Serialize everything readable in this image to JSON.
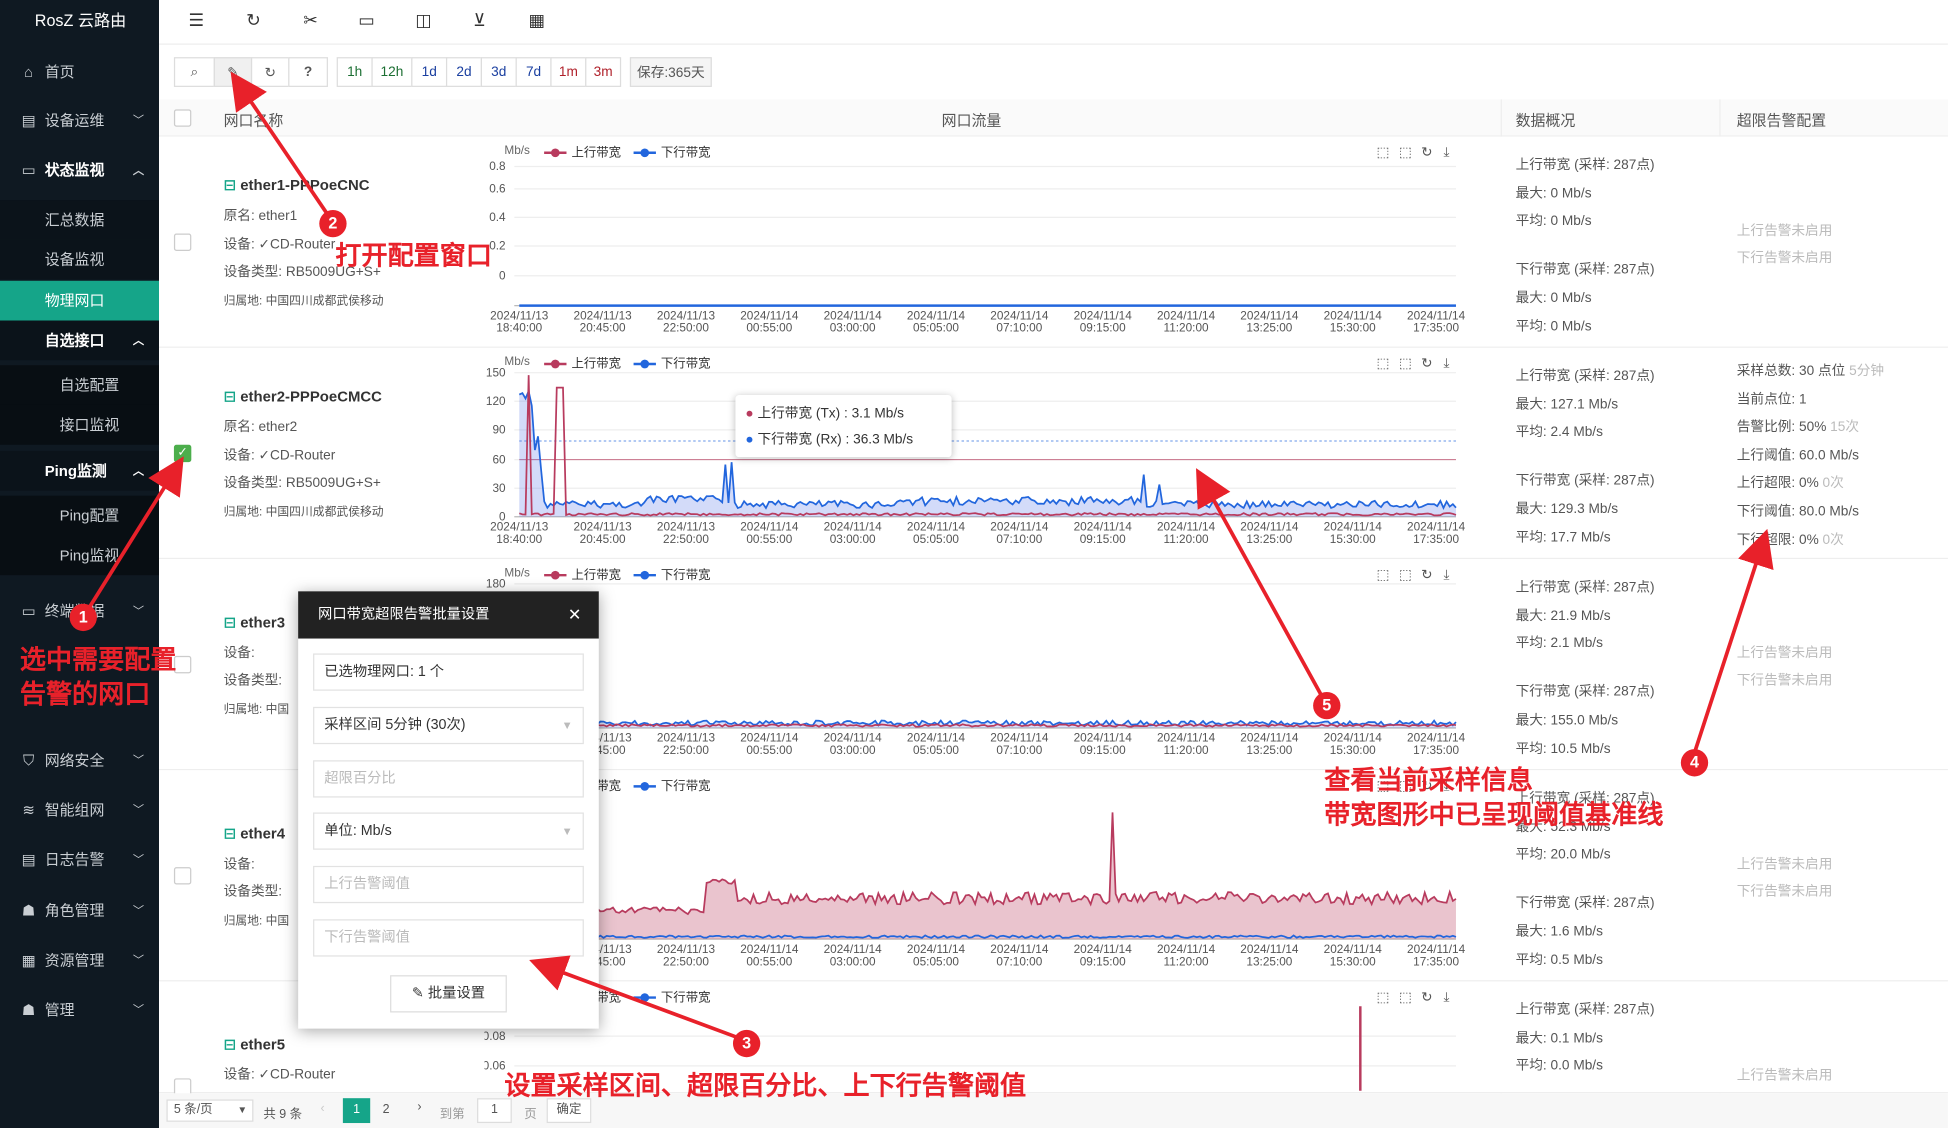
{
  "app": {
    "brand": "RosZ 云路由"
  },
  "sidebar": {
    "items": [
      {
        "label": "首页",
        "icon": "home-icon"
      },
      {
        "label": "设备运维",
        "icon": "toolbox-icon"
      },
      {
        "label": "状态监视",
        "icon": "monitor-icon"
      },
      {
        "label": "汇总数据"
      },
      {
        "label": "设备监视"
      },
      {
        "label": "物理网口"
      },
      {
        "label": "自选接口"
      },
      {
        "label": "自选配置"
      },
      {
        "label": "接口监视"
      },
      {
        "label": "Ping监测"
      },
      {
        "label": "Ping配置"
      },
      {
        "label": "Ping监视"
      },
      {
        "label": "终端数据",
        "icon": "terminal-icon"
      },
      {
        "label": "网络安全",
        "icon": "shield-icon"
      },
      {
        "label": "智能组网",
        "icon": "network-icon"
      },
      {
        "label": "日志告警",
        "icon": "log-icon"
      },
      {
        "label": "角色管理",
        "icon": "users-icon"
      },
      {
        "label": "资源管理",
        "icon": "resource-icon"
      },
      {
        "label": "管理",
        "icon": "user-icon"
      }
    ]
  },
  "toolbar": {
    "periods": [
      "1h",
      "12h",
      "1d",
      "2d",
      "3d",
      "7d",
      "1m",
      "3m"
    ],
    "retention": "保存:365天",
    "help": "?"
  },
  "table": {
    "headers": [
      "网口名称",
      "网口流量",
      "数据概况",
      "超限告警配置"
    ]
  },
  "chart": {
    "unit": "Mb/s",
    "legend_tx": "上行带宽",
    "legend_rx": "下行带宽",
    "tx_color": "#b83b5e",
    "rx_color": "#2266dd",
    "x_dates": [
      "2024/11/13",
      "2024/11/13",
      "2024/11/13",
      "2024/11/14",
      "2024/11/14",
      "2024/11/14",
      "2024/11/14",
      "2024/11/14",
      "2024/11/14",
      "2024/11/14",
      "2024/11/14",
      "2024/11/14"
    ],
    "x_times": [
      "18:40:00",
      "20:45:00",
      "22:50:00",
      "00:55:00",
      "03:00:00",
      "05:05:00",
      "07:10:00",
      "09:15:00",
      "11:20:00",
      "13:25:00",
      "15:30:00",
      "17:35:00"
    ]
  },
  "rows": [
    {
      "name": "ether1-PPPoeCNC",
      "orig": "原名:  ether1",
      "device": "设备:  ✓CD-Router",
      "dtype": "设备类型:  RB5009UG+S+",
      "loc": "归属地: 中国四川成都武侯移动",
      "checked": false,
      "yticks": [
        "0.8",
        "0.6",
        "0.4",
        "0.2",
        "0"
      ],
      "ylabel": "Mb/s",
      "tx_title": "上行带宽 (采样: 287点)",
      "tx_max": "最大:  0 Mb/s",
      "tx_avg": "平均:  0 Mb/s",
      "rx_title": "下行带宽 (采样: 287点)",
      "rx_max": "最大:  0 Mb/s",
      "rx_avg": "平均:  0 Mb/s",
      "alarm": [
        "上行告警未启用",
        "下行告警未启用"
      ]
    },
    {
      "name": "ether2-PPPoeCMCC",
      "orig": "原名:  ether2",
      "device": "设备:  ✓CD-Router",
      "dtype": "设备类型:  RB5009UG+S+",
      "loc": "归属地: 中国四川成都武侯移动",
      "checked": true,
      "yticks": [
        "150",
        "120",
        "90",
        "60",
        "30",
        "0"
      ],
      "ylabel": "Mb/s",
      "tx_title": "上行带宽 (采样: 287点)",
      "tx_max": "最大:  127.1 Mb/s",
      "tx_avg": "平均:  2.4 Mb/s",
      "rx_title": "下行带宽 (采样: 287点)",
      "rx_max": "最大:  129.3 Mb/s",
      "rx_avg": "平均:  17.7 Mb/s",
      "alarm_cfg": [
        {
          "k": "采样总数:  30 点位",
          "m": "5分钟"
        },
        {
          "k": "当前点位:  1",
          "m": ""
        },
        {
          "k": "告警比例:  50%",
          "m": "15次"
        },
        {
          "k": "上行阈值:  60.0 Mb/s",
          "m": ""
        },
        {
          "k": "上行超限:  0%",
          "m": "0次"
        },
        {
          "k": "下行阈值:  80.0 Mb/s",
          "m": ""
        },
        {
          "k": "下行超限:  0%",
          "m": "0次"
        }
      ],
      "tooltip": {
        "tx": "上行带宽 (Tx)  : 3.1 Mb/s",
        "rx": "下行带宽 (Rx)  : 36.3 Mb/s"
      }
    },
    {
      "name": "ether3",
      "device": "设备:",
      "dtype": "设备类型:",
      "loc": "归属地: 中国",
      "checked": false,
      "yticks": [
        "180"
      ],
      "ylabel": "Mb/s",
      "tx_title": "上行带宽 (采样: 287点)",
      "tx_max": "最大:  21.9 Mb/s",
      "tx_avg": "平均:  2.1 Mb/s",
      "rx_title": "下行带宽 (采样: 287点)",
      "rx_max": "最大:  155.0 Mb/s",
      "rx_avg": "平均:  10.5 Mb/s",
      "alarm": [
        "上行告警未启用",
        "下行告警未启用"
      ]
    },
    {
      "name": "ether4",
      "device": "设备:",
      "dtype": "设备类型:",
      "loc": "归属地: 中国",
      "checked": false,
      "tx_title": "上行带宽 (采样: 287点)",
      "tx_max": "最大:  52.3 Mb/s",
      "tx_avg": "平均:  20.0 Mb/s",
      "rx_title": "下行带宽 (采样: 287点)",
      "rx_max": "最大:  1.6 Mb/s",
      "rx_avg": "平均:  0.5 Mb/s",
      "alarm": [
        "上行告警未启用",
        "下行告警未启用"
      ]
    },
    {
      "name": "ether5",
      "device": "设备:  ✓CD-Router",
      "checked": false,
      "yticks": [
        "0.08",
        "0.06"
      ],
      "tx_title": "上行带宽 (采样: 287点)",
      "tx_max": "最大:  0.1 Mb/s",
      "tx_avg": "平均:  0.0 Mb/s",
      "alarm": [
        "上行告警未启用"
      ]
    }
  ],
  "pager": {
    "size": "5 条/页",
    "total": "共 9 条",
    "pages": [
      "1",
      "2"
    ],
    "goto": "到第",
    "page_val": "1",
    "page_unit": "页",
    "confirm": "确定"
  },
  "dialog": {
    "title": "网口带宽超限告警批量设置",
    "selected": "已选物理网口:  1 个",
    "interval": "采样区间 5分钟 (30次)",
    "percent_ph": "超限百分比",
    "unit": "单位:  Mb/s",
    "tx_ph": "上行告警阈值",
    "rx_ph": "下行告警阈值",
    "submit": "批量设置"
  },
  "annotations": {
    "a1": "选中需要配置\n告警的网口",
    "a2": "打开配置窗口",
    "a3": "设置采样区间、超限百分比、上下行告警阈值",
    "a5a": "查看当前采样信息",
    "a5b": "带宽图形中已呈现阈值基准线",
    "n1": "1",
    "n2": "2",
    "n3": "3",
    "n4": "4",
    "n5": "5"
  }
}
